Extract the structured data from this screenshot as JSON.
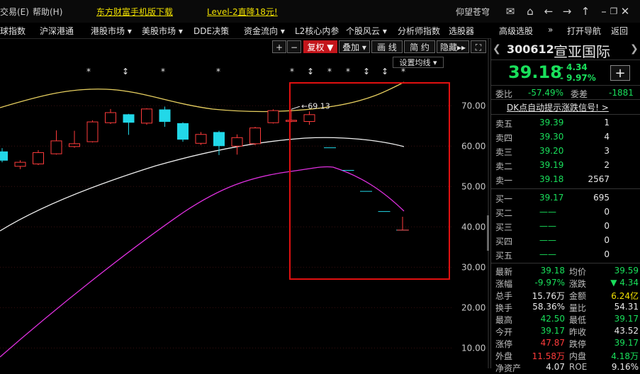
{
  "topbar": {
    "menu": [
      "交易(E)",
      "帮助(H)"
    ],
    "promo1": "东方财富手机版下载",
    "promo2": "Level-2直降18元!",
    "user": "仰望苍穹",
    "icons": [
      "mail-icon",
      "home-icon",
      "back-icon",
      "forward-icon",
      "up-icon",
      "minimize-icon",
      "restore-icon",
      "close-icon"
    ]
  },
  "menubar": {
    "items": [
      "球指数",
      "沪深港通",
      "港股市场 ▾",
      "美股市场 ▾",
      "DDE决策",
      "资金流向 ▾",
      "L2核心内参",
      "个股风云 ▾",
      "分析师指数",
      "选股器",
      "高级选股",
      "»",
      "打开导航",
      "返回"
    ]
  },
  "toolbar": {
    "plus": "+",
    "minus": "−",
    "fuquan": "复权 ▼",
    "diejia": "叠加 ▾",
    "huaxian": "画 线",
    "jianyue": "简 约",
    "yincang": "隐藏▸▸",
    "fullscreen": "⛶",
    "ma_setting": "设置均线 ▾"
  },
  "chart_data": {
    "type": "candlestick",
    "y_ticks": [
      "70.00",
      "60.00",
      "50.00",
      "40.00",
      "30.00",
      "20.00",
      "10.00"
    ],
    "y_values": [
      70,
      60,
      50,
      40,
      30,
      20,
      10
    ],
    "annotation": "69.13",
    "markers": [
      "*",
      "↕",
      "*",
      "*",
      "*",
      "↕",
      "*",
      "*",
      "↕",
      "↕",
      "*"
    ],
    "up_color": "#ff3b3b",
    "down_color": "#22d8e8",
    "candles": [
      {
        "o": 58.6,
        "c": 56.5,
        "h": 59.5,
        "l": 56.0
      },
      {
        "o": 55.0,
        "c": 56.0,
        "h": 56.5,
        "l": 54.3
      },
      {
        "o": 55.6,
        "c": 58.4,
        "h": 59.0,
        "l": 55.3
      },
      {
        "o": 58.1,
        "c": 61.3,
        "h": 63.9,
        "l": 57.9
      },
      {
        "o": 59.9,
        "c": 60.6,
        "h": 63.8,
        "l": 59.6
      },
      {
        "o": 61.1,
        "c": 66.0,
        "h": 66.4,
        "l": 60.9
      },
      {
        "o": 65.8,
        "c": 68.3,
        "h": 69.2,
        "l": 65.5
      },
      {
        "o": 67.8,
        "c": 65.9,
        "h": 68.0,
        "l": 62.8
      },
      {
        "o": 65.7,
        "c": 69.2,
        "h": 69.4,
        "l": 65.3
      },
      {
        "o": 69.0,
        "c": 66.1,
        "h": 69.8,
        "l": 64.8
      },
      {
        "o": 65.6,
        "c": 61.7,
        "h": 65.9,
        "l": 61.1
      },
      {
        "o": 60.7,
        "c": 62.9,
        "h": 63.5,
        "l": 60.3
      },
      {
        "o": 63.4,
        "c": 60.1,
        "h": 63.8,
        "l": 57.8
      },
      {
        "o": 60.0,
        "c": 62.1,
        "h": 62.9,
        "l": 57.9
      },
      {
        "o": 60.6,
        "c": 64.5,
        "h": 64.8,
        "l": 60.2
      },
      {
        "o": 65.8,
        "c": 68.8,
        "h": 69.1,
        "l": 65.6
      },
      {
        "o": 66.3,
        "c": 66.4,
        "h": 69.1,
        "l": 65.9
      },
      {
        "o": 66.1,
        "c": 67.8,
        "h": 68.6,
        "l": 65.3
      }
    ],
    "ghost_levels": [
      59.6,
      54.0,
      48.8,
      43.8,
      39.2
    ]
  },
  "panel": {
    "code": "300612",
    "name": "宣亚国际",
    "price": "39.18",
    "change": "- 4.34",
    "pct": "- 9.97%",
    "weibi_label": "委比",
    "weibi": "-57.49%",
    "weicha_label": "委差",
    "weicha": "-1881",
    "dk_signal": "DK点自动提示涨跌信号! >",
    "asks": [
      {
        "label": "卖五",
        "price": "39.39",
        "vol": "1"
      },
      {
        "label": "卖四",
        "price": "39.30",
        "vol": "4"
      },
      {
        "label": "卖三",
        "price": "39.20",
        "vol": "3"
      },
      {
        "label": "卖二",
        "price": "39.19",
        "vol": "2"
      },
      {
        "label": "卖一",
        "price": "39.18",
        "vol": "2567"
      }
    ],
    "bids": [
      {
        "label": "买一",
        "price": "39.17",
        "vol": "695"
      },
      {
        "label": "买二",
        "price": "——",
        "vol": "0"
      },
      {
        "label": "买三",
        "price": "——",
        "vol": "0"
      },
      {
        "label": "买四",
        "price": "——",
        "vol": "0"
      },
      {
        "label": "买五",
        "price": "——",
        "vol": "0"
      }
    ],
    "stats": [
      {
        "l1": "最新",
        "v1": "39.18",
        "c1": "green",
        "l2": "均价",
        "v2": "39.59",
        "c2": "green"
      },
      {
        "l1": "涨幅",
        "v1": "-9.97%",
        "c1": "green",
        "l2": "涨跌",
        "v2": "▼ 4.34",
        "c2": "green"
      },
      {
        "l1": "总手",
        "v1": "15.76万",
        "c1": "white",
        "l2": "金额",
        "v2": "6.24亿",
        "c2": "yellow"
      },
      {
        "l1": "换手",
        "v1": "58.36%",
        "c1": "white",
        "l2": "量比",
        "v2": "54.31",
        "c2": "white"
      },
      {
        "l1": "最高",
        "v1": "42.50",
        "c1": "green",
        "l2": "最低",
        "v2": "39.17",
        "c2": "green"
      },
      {
        "l1": "今开",
        "v1": "39.17",
        "c1": "green",
        "l2": "昨收",
        "v2": "43.52",
        "c2": "white"
      },
      {
        "l1": "涨停",
        "v1": "47.87",
        "c1": "red",
        "l2": "跌停",
        "v2": "39.17",
        "c2": "green"
      },
      {
        "l1": "外盘",
        "v1": "11.58万",
        "c1": "red",
        "l2": "内盘",
        "v2": "4.18万",
        "c2": "green"
      },
      {
        "l1": "净资产",
        "v1": "4.07",
        "c1": "white",
        "l2": "ROE",
        "v2": "9.16%",
        "c2": "white"
      }
    ]
  }
}
